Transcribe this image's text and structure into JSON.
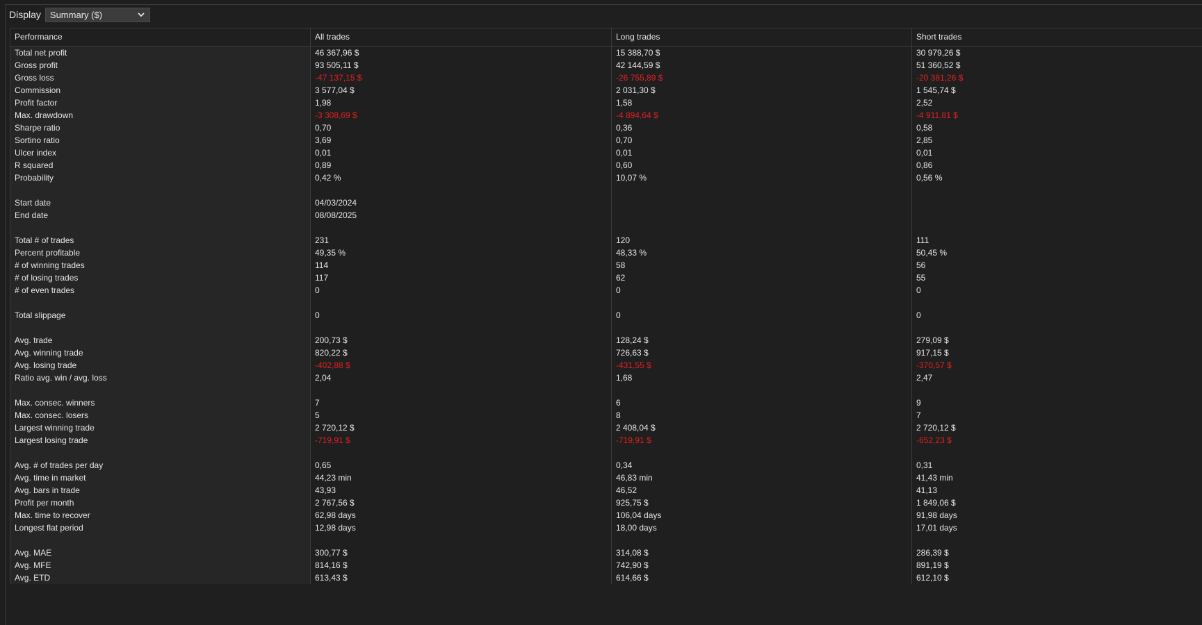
{
  "display": {
    "label": "Display",
    "selected": "Summary ($)"
  },
  "columns": [
    "Performance",
    "All trades",
    "Long trades",
    "Short trades"
  ],
  "rows": [
    {
      "label": "Total net profit",
      "values": [
        "46 367,96 $",
        "15 388,70 $",
        "30 979,26 $"
      ]
    },
    {
      "label": "Gross profit",
      "values": [
        "93 505,11 $",
        "42 144,59 $",
        "51 360,52 $"
      ]
    },
    {
      "label": "Gross loss",
      "values": [
        "-47 137,15 $",
        "-26 755,89 $",
        "-20 381,26 $"
      ],
      "negative": true
    },
    {
      "label": "Commission",
      "values": [
        "3 577,04 $",
        "2 031,30 $",
        "1 545,74 $"
      ]
    },
    {
      "label": "Profit factor",
      "values": [
        "1,98",
        "1,58",
        "2,52"
      ]
    },
    {
      "label": "Max. drawdown",
      "values": [
        "-3 308,69 $",
        "-4 894,64 $",
        "-4 911,81 $"
      ],
      "negative": true
    },
    {
      "label": "Sharpe ratio",
      "values": [
        "0,70",
        "0,36",
        "0,58"
      ]
    },
    {
      "label": "Sortino ratio",
      "values": [
        "3,69",
        "0,70",
        "2,85"
      ]
    },
    {
      "label": "Ulcer index",
      "values": [
        "0,01",
        "0,01",
        "0,01"
      ]
    },
    {
      "label": "R squared",
      "values": [
        "0,89",
        "0,60",
        "0,86"
      ]
    },
    {
      "label": "Probability",
      "values": [
        "0,42 %",
        "10,07 %",
        "0,56 %"
      ]
    },
    {
      "label": "",
      "values": [
        "",
        "",
        ""
      ]
    },
    {
      "label": "Start date",
      "values": [
        "04/03/2024",
        "",
        ""
      ]
    },
    {
      "label": "End date",
      "values": [
        "08/08/2025",
        "",
        ""
      ]
    },
    {
      "label": "",
      "values": [
        "",
        "",
        ""
      ]
    },
    {
      "label": "Total # of trades",
      "values": [
        "231",
        "120",
        "111"
      ]
    },
    {
      "label": "Percent profitable",
      "values": [
        "49,35 %",
        "48,33 %",
        "50,45 %"
      ]
    },
    {
      "label": "# of winning trades",
      "values": [
        "114",
        "58",
        "56"
      ]
    },
    {
      "label": "# of losing trades",
      "values": [
        "117",
        "62",
        "55"
      ]
    },
    {
      "label": "# of even trades",
      "values": [
        "0",
        "0",
        "0"
      ]
    },
    {
      "label": "",
      "values": [
        "",
        "",
        ""
      ]
    },
    {
      "label": "Total slippage",
      "values": [
        "0",
        "0",
        "0"
      ]
    },
    {
      "label": "",
      "values": [
        "",
        "",
        ""
      ]
    },
    {
      "label": "Avg. trade",
      "values": [
        "200,73 $",
        "128,24 $",
        "279,09 $"
      ]
    },
    {
      "label": "Avg. winning trade",
      "values": [
        "820,22 $",
        "726,63 $",
        "917,15 $"
      ]
    },
    {
      "label": "Avg. losing trade",
      "values": [
        "-402,88 $",
        "-431,55 $",
        "-370,57 $"
      ],
      "negative": true
    },
    {
      "label": "Ratio avg. win / avg. loss",
      "values": [
        "2,04",
        "1,68",
        "2,47"
      ]
    },
    {
      "label": "",
      "values": [
        "",
        "",
        ""
      ]
    },
    {
      "label": "Max. consec. winners",
      "values": [
        "7",
        "6",
        "9"
      ]
    },
    {
      "label": "Max. consec. losers",
      "values": [
        "5",
        "8",
        "7"
      ]
    },
    {
      "label": "Largest winning trade",
      "values": [
        "2 720,12 $",
        "2 408,04 $",
        "2 720,12 $"
      ]
    },
    {
      "label": "Largest losing trade",
      "values": [
        "-719,91 $",
        "-719,91 $",
        "-652,23 $"
      ],
      "negative": true
    },
    {
      "label": "",
      "values": [
        "",
        "",
        ""
      ]
    },
    {
      "label": "Avg. # of trades per day",
      "values": [
        "0,65",
        "0,34",
        "0,31"
      ]
    },
    {
      "label": "Avg. time in market",
      "values": [
        "44,23 min",
        "46,83 min",
        "41,43 min"
      ]
    },
    {
      "label": "Avg. bars in trade",
      "values": [
        "43,93",
        "46,52",
        "41,13"
      ]
    },
    {
      "label": "Profit per month",
      "values": [
        "2 767,56 $",
        "925,75 $",
        "1 849,06 $"
      ]
    },
    {
      "label": "Max. time to recover",
      "values": [
        "62,98 days",
        "106,04 days",
        "91,98 days"
      ]
    },
    {
      "label": "Longest flat period",
      "values": [
        "12,98 days",
        "18,00 days",
        "17,01 days"
      ]
    },
    {
      "label": "",
      "values": [
        "",
        "",
        ""
      ]
    },
    {
      "label": "Avg. MAE",
      "values": [
        "300,77 $",
        "314,08 $",
        "286,39 $"
      ]
    },
    {
      "label": "Avg. MFE",
      "values": [
        "814,16 $",
        "742,90 $",
        "891,19 $"
      ]
    },
    {
      "label": "Avg. ETD",
      "values": [
        "613,43 $",
        "614,66 $",
        "612,10 $"
      ]
    }
  ],
  "colors": {
    "negative": "#e02020",
    "text": "#e6e6e6",
    "background": "#1f1f1f",
    "label_column": "#262626"
  }
}
